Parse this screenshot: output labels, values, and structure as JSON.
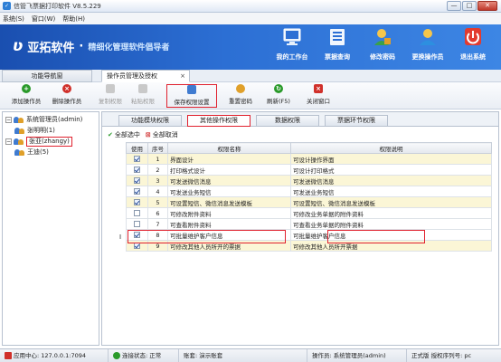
{
  "window": {
    "title": "信管飞票据打印软件 V8.5.229",
    "buttons": [
      "—",
      "□",
      "✕"
    ]
  },
  "menu": [
    "系统(S)",
    "窗口(W)",
    "帮助(H)"
  ],
  "banner": {
    "logo_mark": "ʋ",
    "brand": "亚拓软件",
    "separator": "·",
    "slogan": "精细化管理软件倡导者",
    "items": [
      {
        "label": "我的工作台",
        "icon": "monitor-icon",
        "color": "#e8f1fb"
      },
      {
        "label": "票据查询",
        "icon": "list-icon",
        "color": "#f1f6fd"
      },
      {
        "label": "修改密码",
        "icon": "user-lock-icon",
        "color": "#f6c64a"
      },
      {
        "label": "更换操作员",
        "icon": "user-switch-icon",
        "color": "#f6c64a"
      },
      {
        "label": "退出系统",
        "icon": "power-icon",
        "color": "#e23b2f"
      }
    ]
  },
  "tabs": {
    "nav": "功能导航窗",
    "active": "操作员管理及授权",
    "close": "×"
  },
  "toolbar": [
    {
      "label": "添加操作员",
      "icon": "add-icon",
      "color": "#2a9a2a",
      "disabled": false
    },
    {
      "label": "删除操作员",
      "icon": "delete-icon",
      "color": "#d0302a",
      "disabled": false
    },
    {
      "label": "复制权限",
      "icon": "copy-icon",
      "color": "#c9c9c9",
      "disabled": true
    },
    {
      "label": "粘贴权限",
      "icon": "paste-icon",
      "color": "#c9c9c9",
      "disabled": true
    },
    {
      "label": "保存权限设置",
      "icon": "save-icon",
      "color": "#3f7bd0",
      "disabled": false
    },
    {
      "label": "重置密码",
      "icon": "key-icon",
      "color": "#e0a02a",
      "disabled": false
    },
    {
      "label": "刷新(F5)",
      "icon": "refresh-icon",
      "color": "#2a9a2a",
      "disabled": false
    },
    {
      "label": "关闭窗口",
      "icon": "close-window-icon",
      "color": "#d0302a",
      "disabled": false
    }
  ],
  "tree": [
    {
      "label": "系统管理员(admin)",
      "level": 0,
      "selected": false
    },
    {
      "label": "张明明(1)",
      "level": 1,
      "selected": false
    },
    {
      "label": "张亚(zhangy)",
      "level": 0,
      "selected": true
    },
    {
      "label": "王迪(5)",
      "level": 1,
      "selected": false
    }
  ],
  "subtabs": [
    "功能模块权限",
    "其他操作权限",
    "数据权限",
    "票据环节权限"
  ],
  "active_subtab": 1,
  "selbar": {
    "select_all": "全部选中",
    "deselect_all": "全部取消"
  },
  "grid": {
    "headers": [
      "使用",
      "序号",
      "权限名称",
      "权限说明"
    ],
    "rows": [
      {
        "checked": true,
        "no": "1",
        "name": "界面设计",
        "desc": "可设计操作界面"
      },
      {
        "checked": true,
        "no": "2",
        "name": "打印格式设计",
        "desc": "可设计打印格式"
      },
      {
        "checked": true,
        "no": "3",
        "name": "可发送微信消息",
        "desc": "可发送微信消息"
      },
      {
        "checked": true,
        "no": "4",
        "name": "可发送业务短信",
        "desc": "可发送业务短信"
      },
      {
        "checked": true,
        "no": "5",
        "name": "可设置短信、微信消息发送模板",
        "desc": "可设置短信、微信消息发送模板"
      },
      {
        "checked": false,
        "no": "6",
        "name": "可修改附件资料",
        "desc": "可修改业务单据的附件资料"
      },
      {
        "checked": false,
        "no": "7",
        "name": "可查看附件资料",
        "desc": "可查看业务单据的附件资料"
      },
      {
        "checked": true,
        "no": "8",
        "name": "可批量维护客户信息",
        "desc": "可批量维护客户信息"
      },
      {
        "checked": true,
        "no": "9",
        "name": "可修改其他人员所开的票据",
        "desc": "可修改其他人员所开票据"
      }
    ]
  },
  "cursor_marker": "I",
  "status": [
    {
      "label": "应用中心: 127.0.0.1:7094",
      "icon": "red"
    },
    {
      "label": "连接状态: 正常",
      "icon": "green"
    },
    {
      "label": "账套: 演示账套",
      "icon": ""
    },
    {
      "label": "操作员: 系统管理员(admin)",
      "icon": ""
    },
    {
      "label": "正式版 授权序列号: pc",
      "icon": ""
    }
  ]
}
